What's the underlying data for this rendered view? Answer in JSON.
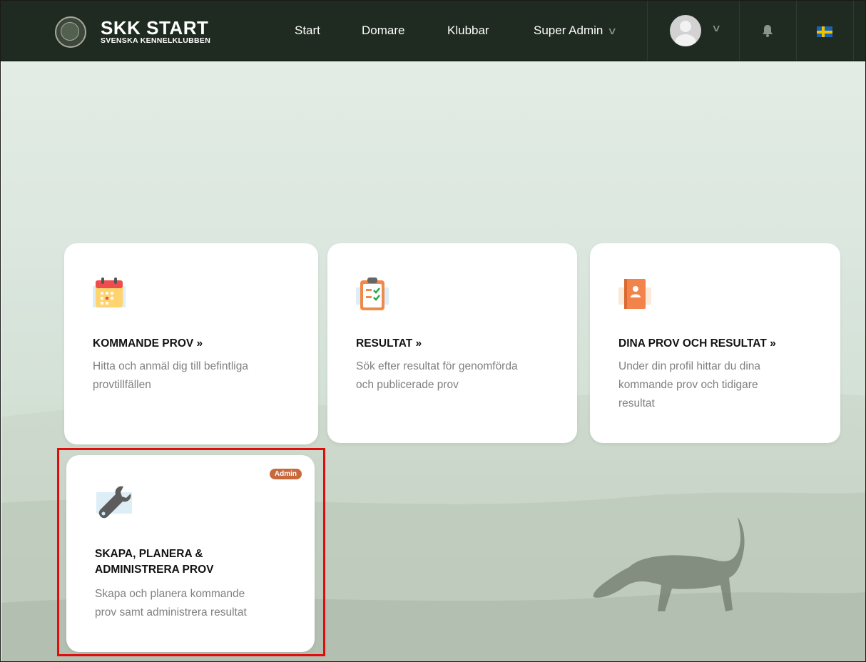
{
  "brand": {
    "title": "SKK START",
    "subtitle": "SVENSKA KENNELKLUBBEN"
  },
  "nav": {
    "items": [
      "Start",
      "Domare",
      "Klubbar"
    ],
    "admin_menu": "Super Admin"
  },
  "icons": {
    "user_menu": "user-avatar-icon",
    "notifications": "bell-icon",
    "language": "swedish-flag-icon",
    "dropdown": "chevron-down-icon"
  },
  "cards": [
    {
      "title": "KOMMANDE PROV »",
      "desc1": "Hitta och anmäl dig till befintliga",
      "desc2": "provtillfällen",
      "icon": "calendar-icon"
    },
    {
      "title": "RESULTAT »",
      "desc1": "Sök efter resultat för genomförda",
      "desc2": "och publicerade prov",
      "icon": "clipboard-check-icon"
    },
    {
      "title": "DINA PROV OCH RESULTAT »",
      "desc1": "Under din profil hittar du dina",
      "desc2": "kommande prov och tidigare",
      "desc3": "resultat",
      "icon": "profile-book-icon"
    },
    {
      "badge": "Admin",
      "title1": "SKAPA, PLANERA &",
      "title2": "ADMINISTRERA PROV",
      "desc1": "Skapa och planera kommande",
      "desc2": "prov samt administrera resultat",
      "icon": "wrench-icon"
    }
  ],
  "colors": {
    "nav_bg": "#1f2a20",
    "badge": "#c9693b",
    "highlight": "#e10c0c"
  }
}
